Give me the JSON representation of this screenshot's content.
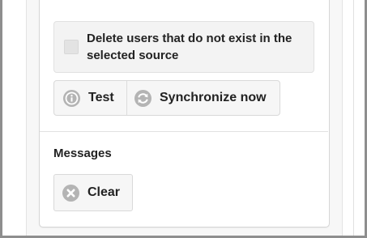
{
  "options": {
    "delete_users_label": "Delete users that do not exist in the selected source",
    "delete_users_checked": false
  },
  "actions": {
    "test_label": "Test",
    "sync_label": "Synchronize now"
  },
  "messages": {
    "heading": "Messages",
    "clear_label": "Clear"
  },
  "icons": {
    "test": "info-icon",
    "sync": "refresh-icon",
    "clear": "close-circle-icon"
  },
  "colors": {
    "icon_gray": "#b4b4b4",
    "panel_border": "#d6d6d6",
    "button_bg": "#f6f6f6"
  }
}
